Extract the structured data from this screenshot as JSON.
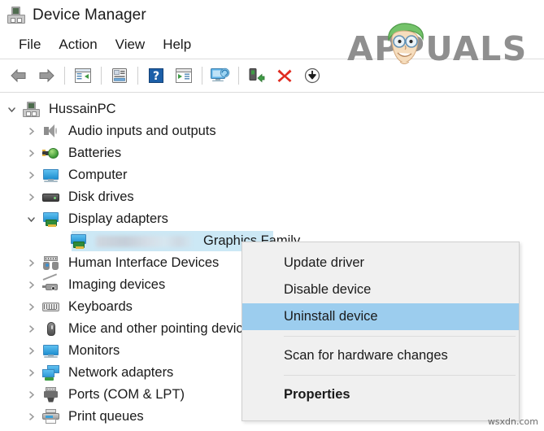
{
  "window": {
    "title": "Device Manager",
    "title_icon": "computer-device-icon"
  },
  "menubar": {
    "items": [
      {
        "label": "File"
      },
      {
        "label": "Action"
      },
      {
        "label": "View"
      },
      {
        "label": "Help"
      }
    ]
  },
  "toolbar": {
    "buttons": [
      {
        "name": "back-icon",
        "tooltip": "Back"
      },
      {
        "name": "forward-icon",
        "tooltip": "Forward"
      },
      {
        "name": "show-hide-tree-icon",
        "tooltip": "Show/Hide console tree"
      },
      {
        "name": "properties-icon",
        "tooltip": "Properties"
      },
      {
        "name": "help-icon",
        "tooltip": "Help"
      },
      {
        "name": "update-driver-icon",
        "tooltip": "Update driver"
      },
      {
        "name": "scan-hardware-icon",
        "tooltip": "Scan for hardware changes"
      },
      {
        "name": "enable-device-icon",
        "tooltip": "Enable device"
      },
      {
        "name": "uninstall-device-icon",
        "tooltip": "Uninstall device"
      },
      {
        "name": "disable-device-icon",
        "tooltip": "Disable device"
      }
    ]
  },
  "tree": {
    "root": {
      "label": "HussainPC",
      "expanded": true,
      "icon": "computer-device-icon"
    },
    "nodes": [
      {
        "label": "Audio inputs and outputs",
        "icon": "speaker-icon",
        "expanded": false,
        "level": 1
      },
      {
        "label": "Batteries",
        "icon": "battery-icon",
        "expanded": false,
        "level": 1
      },
      {
        "label": "Computer",
        "icon": "monitor-icon",
        "expanded": false,
        "level": 1
      },
      {
        "label": "Disk drives",
        "icon": "disk-drive-icon",
        "expanded": false,
        "level": 1
      },
      {
        "label": "Display adapters",
        "icon": "display-adapter-icon",
        "expanded": true,
        "level": 1
      },
      {
        "label": "Graphics Family",
        "icon": "display-adapter-icon",
        "expanded": null,
        "level": 2,
        "selected": true,
        "redacted_prefix": true
      },
      {
        "label": "Human Interface Devices",
        "icon": "hid-icon",
        "expanded": false,
        "level": 1
      },
      {
        "label": "Imaging devices",
        "icon": "camera-icon",
        "expanded": false,
        "level": 1
      },
      {
        "label": "Keyboards",
        "icon": "keyboard-icon",
        "expanded": false,
        "level": 1
      },
      {
        "label": "Mice and other pointing devices",
        "icon": "mouse-icon",
        "expanded": false,
        "level": 1
      },
      {
        "label": "Monitors",
        "icon": "monitor-icon",
        "expanded": false,
        "level": 1
      },
      {
        "label": "Network adapters",
        "icon": "network-adapter-icon",
        "expanded": false,
        "level": 1
      },
      {
        "label": "Ports (COM & LPT)",
        "icon": "port-icon",
        "expanded": false,
        "level": 1
      },
      {
        "label": "Print queues",
        "icon": "printer-icon",
        "expanded": false,
        "level": 1
      }
    ]
  },
  "context_menu": {
    "items": [
      {
        "label": "Update driver",
        "highlighted": false,
        "bold": false
      },
      {
        "label": "Disable device",
        "highlighted": false,
        "bold": false
      },
      {
        "label": "Uninstall device",
        "highlighted": true,
        "bold": false
      },
      {
        "label": "Scan for hardware changes",
        "highlighted": false,
        "bold": false
      },
      {
        "label": "Properties",
        "highlighted": false,
        "bold": true
      }
    ]
  },
  "watermarks": {
    "brand": "APPUALS",
    "site": "wsxdn.com"
  },
  "colors": {
    "menu_highlight": "#9ccdee",
    "tree_selection": "#cce8f5",
    "menu_background": "#f0f0f0",
    "window_background": "#ffffff",
    "text": "#1a1a1a",
    "brand_gray": "#8f8f8f"
  }
}
